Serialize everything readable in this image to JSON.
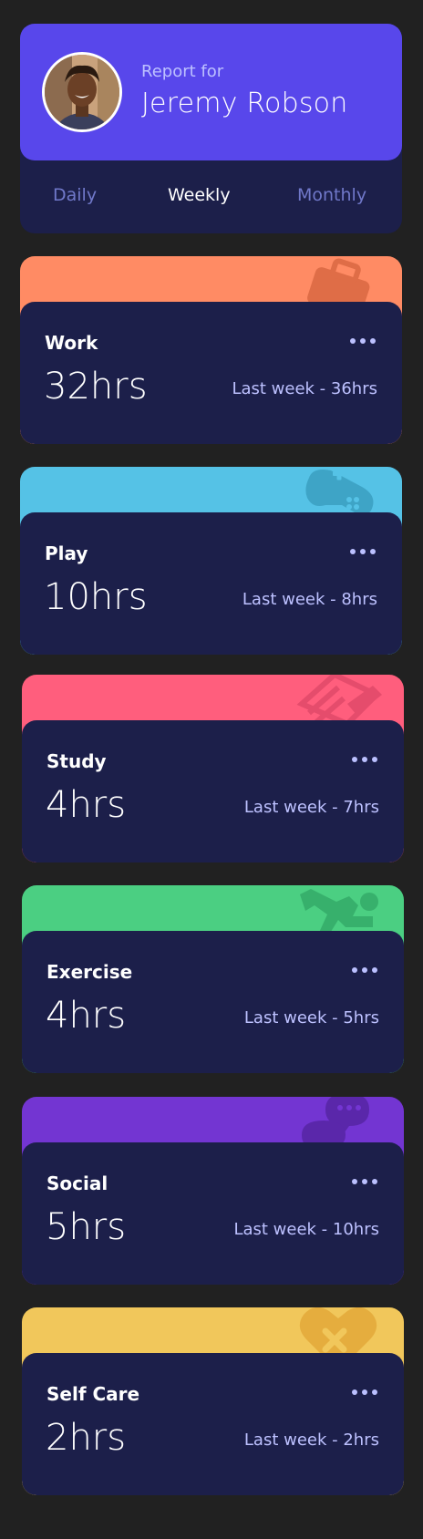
{
  "profile": {
    "label": "Report for",
    "name": "Jeremy Robson",
    "avatar": "user-photo",
    "tabs": [
      {
        "label": "Daily",
        "active": false
      },
      {
        "label": "Weekly",
        "active": true
      },
      {
        "label": "Monthly",
        "active": false
      }
    ]
  },
  "cards": [
    {
      "title": "Work",
      "current": "32hrs",
      "previous": "Last week - 36hrs",
      "color": "#ff8b64",
      "icon": "briefcase-icon"
    },
    {
      "title": "Play",
      "current": "10hrs",
      "previous": "Last week - 8hrs",
      "color": "#55c2e6",
      "icon": "gamepad-icon"
    },
    {
      "title": "Study",
      "current": "4hrs",
      "previous": "Last week - 7hrs",
      "color": "#ff5e7d",
      "icon": "book-icon"
    },
    {
      "title": "Exercise",
      "current": "4hrs",
      "previous": "Last week - 5hrs",
      "color": "#4bcf82",
      "icon": "running-icon"
    },
    {
      "title": "Social",
      "current": "5hrs",
      "previous": "Last week - 10hrs",
      "color": "#7335d2",
      "icon": "chat-icon"
    },
    {
      "title": "Self Care",
      "current": "2hrs",
      "previous": "Last week - 2hrs",
      "color": "#f1c75b",
      "icon": "heart-icon"
    }
  ],
  "colors": {
    "background": "#212121",
    "profile_accent": "#5847eb",
    "card_body": "#1c1f4a",
    "muted_text": "#bdc1ff",
    "tab_inactive": "#7078c9"
  }
}
